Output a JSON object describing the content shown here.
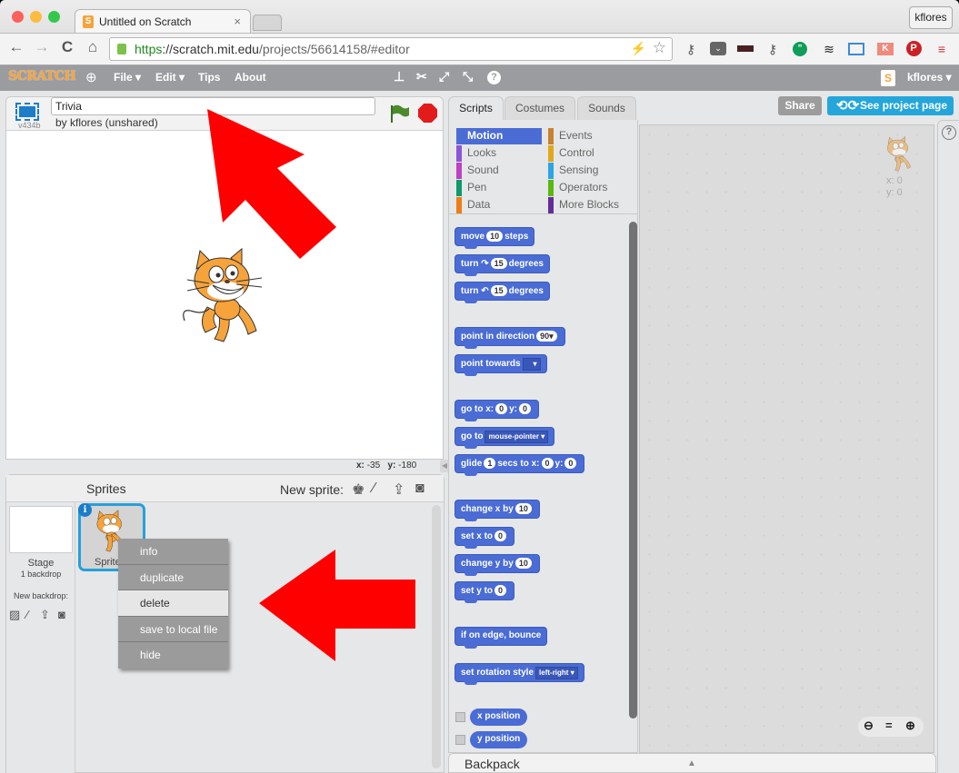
{
  "browser": {
    "tab_title": "Untitled on Scratch",
    "profile_button": "kflores",
    "url_scheme": "https",
    "url_host": "://scratch.mit.edu",
    "url_path": "/projects/56614158/#editor",
    "nav": {
      "back": "←",
      "forward": "→",
      "reload": "C",
      "home": "⌂"
    },
    "extensions": [
      "key-icon",
      "pocket-icon",
      "incognito-mask-icon",
      "key-icon",
      "hangouts-icon",
      "buffer-icon",
      "window-capture-icon",
      "klout-icon",
      "pinterest-icon",
      "menu-icon"
    ]
  },
  "menubar": {
    "logo": "SCRATCH",
    "file": "File ▾",
    "edit": "Edit ▾",
    "tips": "Tips",
    "about": "About",
    "username": "kflores ▾"
  },
  "stage": {
    "project_title": "Trivia",
    "byline": "by kflores (unshared)",
    "version": "v434b",
    "mouse_x_label": "x:",
    "mouse_x": "-35",
    "mouse_y_label": "y:",
    "mouse_y": "-180"
  },
  "sprites": {
    "header": "Sprites",
    "new_sprite_label": "New sprite:",
    "stage_name": "Stage",
    "stage_backdrops": "1 backdrop",
    "new_backdrop_label": "New backdrop:",
    "sprite_name": "Sprite1",
    "info_badge": "i",
    "context_menu": [
      {
        "label": "info",
        "highlighted": false
      },
      {
        "label": "duplicate",
        "highlighted": false
      },
      {
        "label": "delete",
        "highlighted": true
      },
      {
        "label": "save to local file",
        "highlighted": false
      },
      {
        "label": "hide",
        "highlighted": false
      }
    ]
  },
  "editor": {
    "tabs": [
      "Scripts",
      "Costumes",
      "Sounds"
    ],
    "active_tab": "Scripts",
    "share": "Share",
    "see_project_page": "See project page",
    "categories": [
      {
        "label": "Motion",
        "color": "#4a6cd4",
        "selected": true
      },
      {
        "label": "Looks",
        "color": "#8a55d7"
      },
      {
        "label": "Sound",
        "color": "#bb42c3"
      },
      {
        "label": "Pen",
        "color": "#0e9a6c"
      },
      {
        "label": "Data",
        "color": "#ee7d16"
      },
      {
        "label": "Events",
        "color": "#c88330"
      },
      {
        "label": "Control",
        "color": "#e1a91a"
      },
      {
        "label": "Sensing",
        "color": "#2ca5e2"
      },
      {
        "label": "Operators",
        "color": "#5cb712"
      },
      {
        "label": "More Blocks",
        "color": "#632d99"
      }
    ],
    "blocks": {
      "move": {
        "a": "move",
        "n": "10",
        "b": "steps"
      },
      "turn_right": {
        "a": "turn",
        "n": "15",
        "b": "degrees"
      },
      "turn_left": {
        "a": "turn",
        "n": "15",
        "b": "degrees"
      },
      "point_dir": {
        "a": "point in direction",
        "n": "90▾"
      },
      "point_towards": {
        "a": "point towards",
        "dd": "▾"
      },
      "goto_xy": {
        "a": "go to x:",
        "x": "0",
        "b": "y:",
        "y": "0"
      },
      "goto": {
        "a": "go to",
        "dd": "mouse-pointer ▾"
      },
      "glide": {
        "a": "glide",
        "n": "1",
        "b": "secs to x:",
        "x": "0",
        "c": "y:",
        "y": "0"
      },
      "change_x": {
        "a": "change x by",
        "n": "10"
      },
      "set_x": {
        "a": "set x to",
        "n": "0"
      },
      "change_y": {
        "a": "change y by",
        "n": "10"
      },
      "set_y": {
        "a": "set y to",
        "n": "0"
      },
      "bounce": {
        "a": "if on edge, bounce"
      },
      "rotation_style": {
        "a": "set rotation style",
        "dd": "left-right ▾"
      },
      "x_position": "x position",
      "y_position": "y position"
    },
    "sprite_x": "x: 0",
    "sprite_y": "y: 0",
    "zoom_out": "−",
    "zoom_reset": "=",
    "zoom_in": "+",
    "help": "?",
    "backpack": "Backpack",
    "backpack_arrow": "▲"
  }
}
